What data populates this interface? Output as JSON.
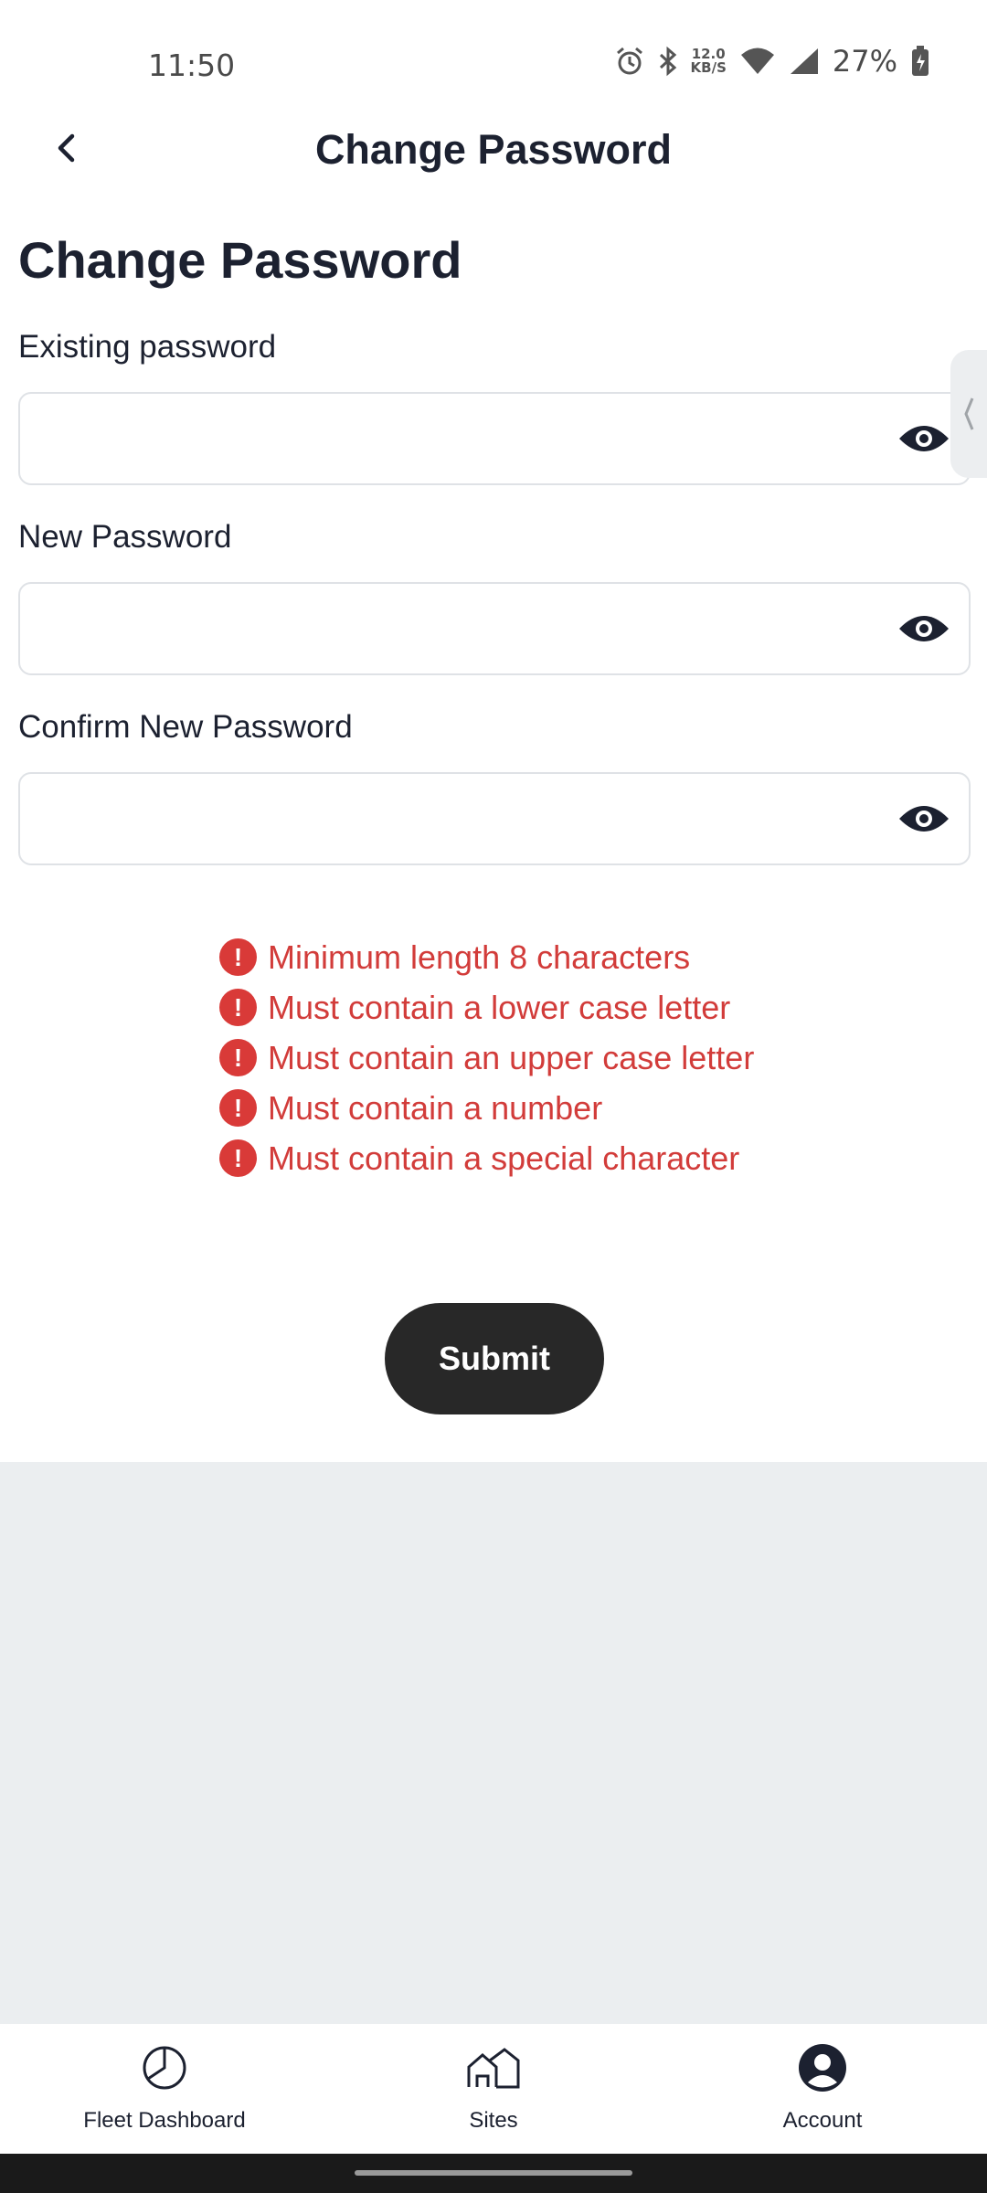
{
  "status_bar": {
    "time": "11:50",
    "net_speed_value": "12.0",
    "net_speed_unit": "KB/S",
    "battery": "27%",
    "icons": [
      "alarm-icon",
      "bluetooth-icon",
      "wifi-icon",
      "cell-signal-icon",
      "battery-charging-icon"
    ]
  },
  "app_bar": {
    "title": "Change Password",
    "back_icon": "chevron-left-icon"
  },
  "form": {
    "heading": "Change Password",
    "fields": [
      {
        "label": "Existing password",
        "value": ""
      },
      {
        "label": "New Password",
        "value": ""
      },
      {
        "label": "Confirm New Password",
        "value": ""
      }
    ],
    "toggle_icon": "eye-icon"
  },
  "validation": {
    "color": "#d93a38",
    "icon_glyph": "!",
    "rules": [
      "Minimum length 8 characters",
      "Must contain a lower case letter",
      "Must contain an upper case letter",
      "Must contain a number",
      "Must contain a special character"
    ]
  },
  "submit": {
    "label": "Submit"
  },
  "bottom_nav": {
    "items": [
      {
        "label": "Fleet Dashboard",
        "icon": "pie-chart-icon"
      },
      {
        "label": "Sites",
        "icon": "houses-icon"
      },
      {
        "label": "Account",
        "icon": "account-icon"
      }
    ]
  },
  "colors": {
    "text": "#1c2130",
    "button": "#282828",
    "background_grey": "#ebeef0",
    "error": "#d93a38"
  }
}
